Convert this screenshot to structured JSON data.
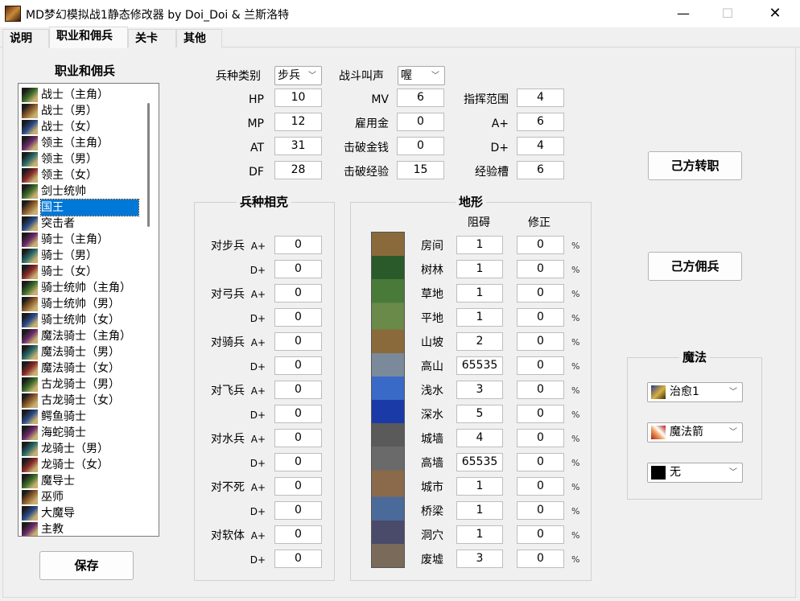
{
  "window": {
    "title": "MD梦幻模拟战1静态修改器 by Doi_Doi & 兰斯洛特",
    "minimize": "—",
    "maximize": "☐",
    "close": "✕"
  },
  "tabs": [
    "说明",
    "职业和佣兵",
    "关卡",
    "其他"
  ],
  "class_list": {
    "heading": "职业和佣兵",
    "selected_index": 7,
    "items": [
      "战士（主角）",
      "战士（男）",
      "战士（女）",
      "领主（主角）",
      "领主（男）",
      "领主（女）",
      "剑士统帅",
      "国王",
      "突击者",
      "骑士（主角）",
      "骑士（男）",
      "骑士（女）",
      "骑士统帅（主角）",
      "骑士统帅（男）",
      "骑士统帅（女）",
      "魔法骑士（主角）",
      "魔法骑士（男）",
      "魔法骑士（女）",
      "古龙骑士（男）",
      "古龙骑士（女）",
      "鳄鱼骑士",
      "海蛇骑士",
      "龙骑士（男）",
      "龙骑士（女）",
      "魔导士",
      "巫师",
      "大魔导",
      "主教"
    ]
  },
  "save_button": "保存",
  "stats": {
    "unit_type_label": "兵种类别",
    "unit_type_value": "步兵",
    "battle_cry_label": "战斗叫声",
    "battle_cry_value": "喔",
    "hp_label": "HP",
    "hp": "10",
    "mp_label": "MP",
    "mp": "12",
    "at_label": "AT",
    "at": "31",
    "df_label": "DF",
    "df": "28",
    "mv_label": "MV",
    "mv": "6",
    "hire_label": "雇用金",
    "hire": "0",
    "gold_label": "击破金钱",
    "gold": "0",
    "exp_label": "击破经验",
    "exp": "15",
    "cmd_range_label": "指挥范围",
    "cmd_range": "4",
    "a_plus_label": "A+",
    "a_plus": "6",
    "d_plus_label": "D+",
    "d_plus": "4",
    "exp_slot_label": "经验槽",
    "exp_slot": "6"
  },
  "counters": {
    "title": "兵种相克",
    "a_label": "A+",
    "d_label": "D+",
    "rows": [
      {
        "name": "对步兵",
        "a": "0",
        "d": "0"
      },
      {
        "name": "对弓兵",
        "a": "0",
        "d": "0"
      },
      {
        "name": "对骑兵",
        "a": "0",
        "d": "0"
      },
      {
        "name": "对飞兵",
        "a": "0",
        "d": "0"
      },
      {
        "name": "对水兵",
        "a": "0",
        "d": "0"
      },
      {
        "name": "对不死",
        "a": "0",
        "d": "0"
      },
      {
        "name": "对软体",
        "a": "0",
        "d": "0"
      }
    ]
  },
  "terrain": {
    "title": "地形",
    "col_block": "阻碍",
    "col_mod": "修正",
    "pct": "%",
    "rows": [
      {
        "name": "房间",
        "block": "1",
        "mod": "0"
      },
      {
        "name": "树林",
        "block": "1",
        "mod": "0"
      },
      {
        "name": "草地",
        "block": "1",
        "mod": "0"
      },
      {
        "name": "平地",
        "block": "1",
        "mod": "0"
      },
      {
        "name": "山坡",
        "block": "2",
        "mod": "0"
      },
      {
        "name": "高山",
        "block": "65535",
        "mod": "0"
      },
      {
        "name": "浅水",
        "block": "3",
        "mod": "0"
      },
      {
        "name": "深水",
        "block": "5",
        "mod": "0"
      },
      {
        "name": "城墙",
        "block": "4",
        "mod": "0"
      },
      {
        "name": "高墙",
        "block": "65535",
        "mod": "0"
      },
      {
        "name": "城市",
        "block": "1",
        "mod": "0"
      },
      {
        "name": "桥梁",
        "block": "1",
        "mod": "0"
      },
      {
        "name": "洞穴",
        "block": "1",
        "mod": "0"
      },
      {
        "name": "废墟",
        "block": "3",
        "mod": "0"
      }
    ]
  },
  "actions": {
    "change_class": "己方转职",
    "mercenary": "己方佣兵"
  },
  "magic": {
    "title": "魔法",
    "slots": [
      "治愈1",
      "魔法箭",
      "无"
    ]
  }
}
